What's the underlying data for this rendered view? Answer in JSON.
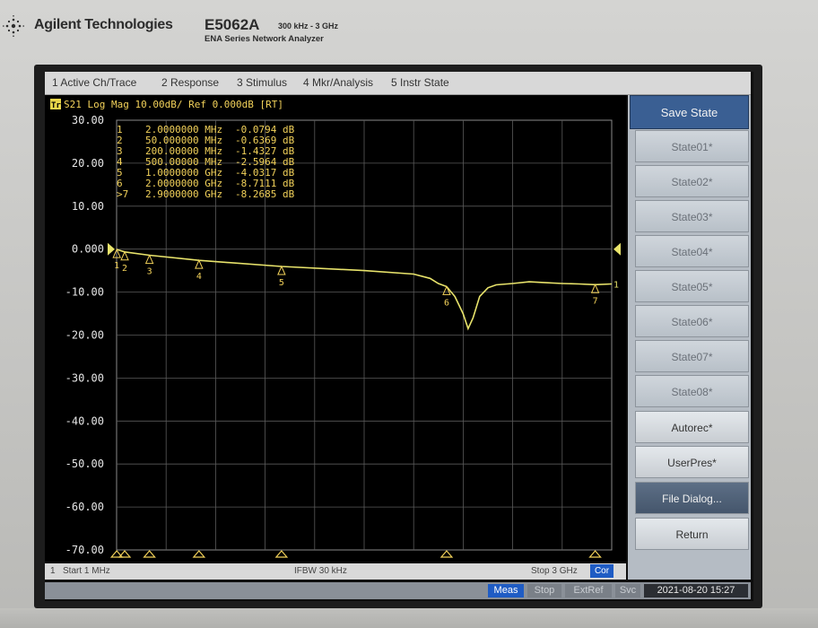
{
  "instrument": {
    "brand": "Agilent Technologies",
    "model": "E5062A",
    "freq_range": "300 kHz - 3 GHz",
    "series": "ENA Series Network Analyzer"
  },
  "menu": [
    "1 Active Ch/Trace",
    "2 Response",
    "3 Stimulus",
    "4 Mkr/Analysis",
    "5 Instr State"
  ],
  "trace_header": {
    "badge": "Tr1",
    "text": "S21  Log Mag 10.00dB/ Ref 0.000dB [RT]"
  },
  "softkeys": {
    "title": "Save State",
    "items": [
      "State01*",
      "State02*",
      "State03*",
      "State04*",
      "State05*",
      "State06*",
      "State07*",
      "State08*",
      "Autorec*",
      "UserPres*",
      "File Dialog...",
      "Return"
    ]
  },
  "bottom": {
    "channel": "1",
    "start": "Start 1 MHz",
    "ifbw": "IFBW 30 kHz",
    "stop": "Stop 3 GHz",
    "cor": "Cor"
  },
  "status": {
    "meas": "Meas",
    "stop": "Stop",
    "extref": "ExtRef",
    "svc": "Svc",
    "datetime": "2021-08-20 15:27"
  },
  "colors": {
    "trace": "#e8e36b",
    "marker_text": "#f3d25a",
    "grid": "#5a5a5a",
    "axis_text": "#e6e6e6"
  },
  "chart_data": {
    "type": "line",
    "title": "",
    "xlabel": "",
    "ylabel": "",
    "x_unit": "GHz",
    "xlim": [
      0.001,
      3.0
    ],
    "ylim": [
      -70,
      30
    ],
    "y_ticks": [
      "30.00",
      "20.00",
      "10.00",
      "0.000",
      "-10.00",
      "-20.00",
      "-30.00",
      "-40.00",
      "-50.00",
      "-60.00",
      "-70.00"
    ],
    "grid": true,
    "reference_level_db": 0,
    "scale_db_per_div": 10,
    "series": [
      {
        "x": [
          0.001,
          0.002,
          0.05,
          0.2,
          0.5,
          1.0,
          1.5,
          1.8,
          1.9,
          1.95,
          2.0,
          2.05,
          2.1,
          2.13,
          2.16,
          2.2,
          2.25,
          2.3,
          2.4,
          2.5,
          2.6,
          2.7,
          2.8,
          2.9,
          3.0
        ],
        "y": [
          -0.05,
          -0.08,
          -0.64,
          -1.43,
          -2.6,
          -4.03,
          -5.0,
          -5.8,
          -6.8,
          -8.0,
          -8.7,
          -11.0,
          -15.0,
          -18.5,
          -16.0,
          -11.0,
          -9.0,
          -8.3,
          -8.0,
          -7.6,
          -7.8,
          -8.0,
          -8.1,
          -8.27,
          -8.1
        ]
      }
    ],
    "markers": [
      {
        "id": "1",
        "freq": "2.0000000 MHz",
        "x": 0.002,
        "value": "-0.0794 dB",
        "y": -0.0794
      },
      {
        "id": "2",
        "freq": "50.000000 MHz",
        "x": 0.05,
        "value": "-0.6369 dB",
        "y": -0.6369
      },
      {
        "id": "3",
        "freq": "200.00000 MHz",
        "x": 0.2,
        "value": "-1.4327 dB",
        "y": -1.4327
      },
      {
        "id": "4",
        "freq": "500.00000 MHz",
        "x": 0.5,
        "value": "-2.5964 dB",
        "y": -2.5964
      },
      {
        "id": "5",
        "freq": "1.0000000 GHz",
        "x": 1.0,
        "value": "-4.0317 dB",
        "y": -4.0317
      },
      {
        "id": "6",
        "freq": "2.0000000 GHz",
        "x": 2.0,
        "value": "-8.7111 dB",
        "y": -8.7111
      },
      {
        "id": ">7",
        "freq": "2.9000000 GHz",
        "x": 2.9,
        "value": "-8.2685 dB",
        "y": -8.2685
      }
    ]
  }
}
